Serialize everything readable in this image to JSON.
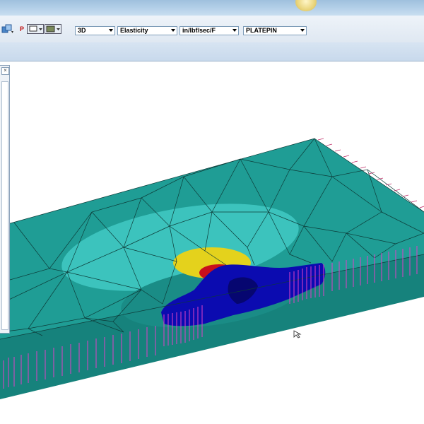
{
  "toolbar": {
    "p_label": "P",
    "view_mode": "3D",
    "analysis_type": "Elasticity",
    "units": "in/lbf/sec/F",
    "model_name": "PLATEPIN"
  },
  "icons": {
    "toolbar_view": "view-icon",
    "toolbar_print": "print-icon",
    "toolbar_camera": "camera-icon",
    "panel_close": "close-icon",
    "cursor": "mouse-cursor-icon"
  },
  "colors": {
    "plate_teal": "#1f9d95",
    "stress_light": "#38c6c0",
    "stress_yellow": "#e8d21a",
    "stress_red": "#c8101c",
    "stress_blue": "#0a0aa8",
    "constraint_magenta": "#e040c8"
  }
}
